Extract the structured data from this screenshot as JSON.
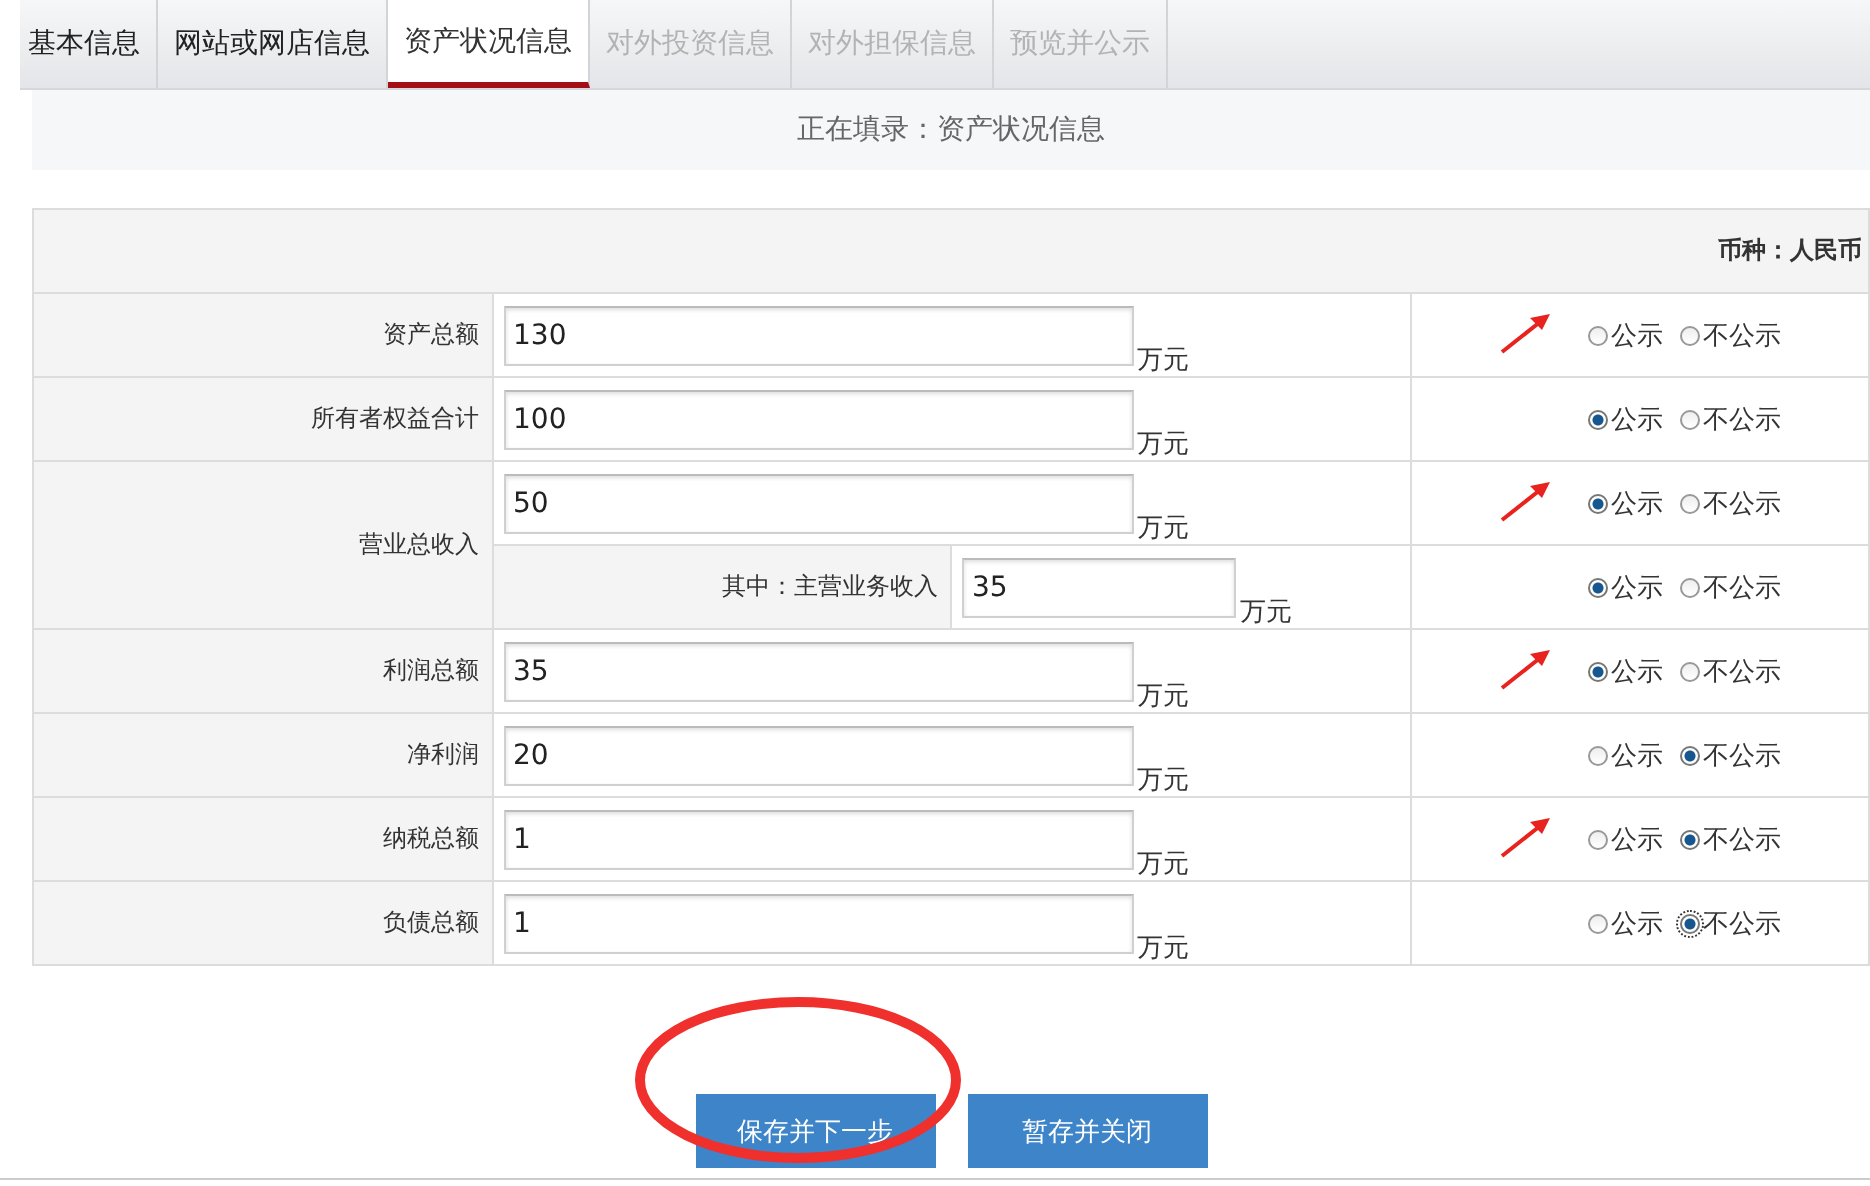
{
  "tabs": [
    {
      "label": "基本信息",
      "selected": false,
      "disabled": false
    },
    {
      "label": "网站或网店信息",
      "selected": false,
      "disabled": false
    },
    {
      "label": "资产状况信息",
      "selected": true,
      "disabled": false
    },
    {
      "label": "对外投资信息",
      "selected": false,
      "disabled": true
    },
    {
      "label": "对外担保信息",
      "selected": false,
      "disabled": true
    },
    {
      "label": "预览并公示",
      "selected": false,
      "disabled": true
    }
  ],
  "status": "正在填录：资产状况信息",
  "currency": "币种：人民币",
  "rows": [
    {
      "label": "资产总额",
      "value": "130",
      "unit": "万元",
      "marked": true,
      "options": [
        {
          "label": "公示",
          "selected": false,
          "focused": false
        },
        {
          "label": "不公示",
          "selected": false,
          "focused": false
        }
      ]
    },
    {
      "label": "所有者权益合计",
      "value": "100",
      "unit": "万元",
      "marked": false,
      "options": [
        {
          "label": "公示",
          "selected": true,
          "focused": false
        },
        {
          "label": "不公示",
          "selected": false,
          "focused": false
        }
      ]
    },
    {
      "label": "营业总收入",
      "value": "50",
      "unit": "万元",
      "marked": true,
      "options": [
        {
          "label": "公示",
          "selected": true,
          "focused": false
        },
        {
          "label": "不公示",
          "selected": false,
          "focused": false
        }
      ],
      "sub": {
        "label": "其中：主营业务收入",
        "value": "35",
        "unit": "万元",
        "marked": false,
        "options": [
          {
            "label": "公示",
            "selected": true,
            "focused": false
          },
          {
            "label": "不公示",
            "selected": false,
            "focused": false
          }
        ]
      }
    },
    {
      "label": "利润总额",
      "value": "35",
      "unit": "万元",
      "marked": true,
      "options": [
        {
          "label": "公示",
          "selected": true,
          "focused": false
        },
        {
          "label": "不公示",
          "selected": false,
          "focused": false
        }
      ]
    },
    {
      "label": "净利润",
      "value": "20",
      "unit": "万元",
      "marked": false,
      "options": [
        {
          "label": "公示",
          "selected": false,
          "focused": false
        },
        {
          "label": "不公示",
          "selected": true,
          "focused": false
        }
      ]
    },
    {
      "label": "纳税总额",
      "value": "1",
      "unit": "万元",
      "marked": true,
      "options": [
        {
          "label": "公示",
          "selected": false,
          "focused": false
        },
        {
          "label": "不公示",
          "selected": true,
          "focused": false
        }
      ]
    },
    {
      "label": "负债总额",
      "value": "1",
      "unit": "万元",
      "marked": false,
      "options": [
        {
          "label": "公示",
          "selected": false,
          "focused": false
        },
        {
          "label": "不公示",
          "selected": true,
          "focused": true
        }
      ]
    }
  ],
  "buttons": [
    {
      "label": "保存并下一步",
      "circled": true
    },
    {
      "label": "暂存并关闭",
      "circled": false
    }
  ]
}
